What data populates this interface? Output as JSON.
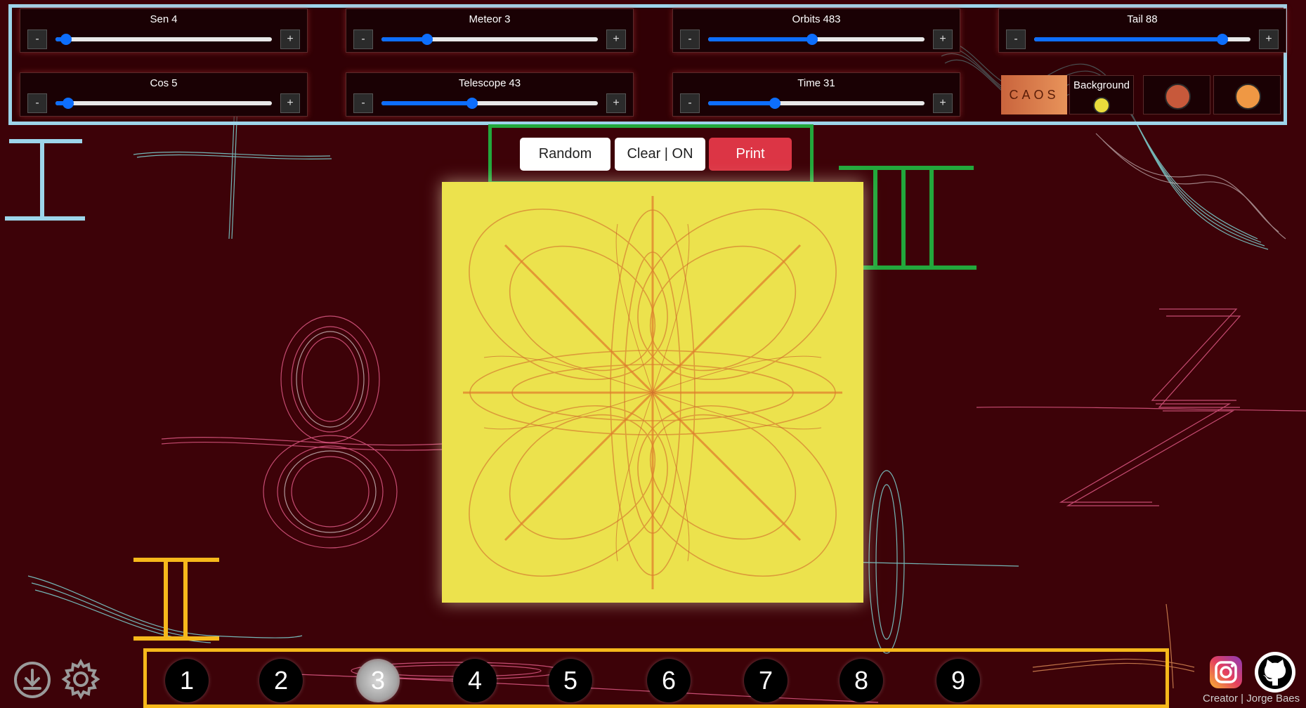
{
  "sliders": [
    {
      "label": "Sen",
      "value": "4",
      "fraction": 0.05
    },
    {
      "label": "Meteor",
      "value": "3",
      "fraction": 0.21
    },
    {
      "label": "Orbits",
      "value": "483",
      "fraction": 0.48
    },
    {
      "label": "Tail",
      "value": "88",
      "fraction": 0.87
    },
    {
      "label": "Cos",
      "value": "5",
      "fraction": 0.06
    },
    {
      "label": "Telescope",
      "value": "43",
      "fraction": 0.42
    },
    {
      "label": "Time",
      "value": "31",
      "fraction": 0.31
    }
  ],
  "minus_label": "-",
  "plus_label": "+",
  "caos_label": "CAOS",
  "background_label": "Background",
  "colors": {
    "background_swatch": "#e9dc3c",
    "color_1": "#c7593b",
    "color_2": "#ef9844",
    "page_bg": "#3d0208",
    "canvas_bg": "#ece24d",
    "accent_blue": "#0d6efd",
    "print_red": "#dc3545"
  },
  "buttons": {
    "random": "Random",
    "clear": "Clear | ON",
    "print": "Print"
  },
  "presets": [
    "1",
    "2",
    "3",
    "4",
    "5",
    "6",
    "7",
    "8",
    "9"
  ],
  "active_preset": "3",
  "icons": [
    "download-icon",
    "settings-gear-icon",
    "instagram-icon",
    "github-icon"
  ],
  "credit": "Creator | Jorge Baes"
}
